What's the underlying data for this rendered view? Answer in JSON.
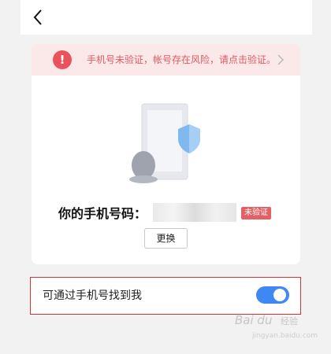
{
  "header": {
    "back_icon": "chevron-left-icon"
  },
  "warning": {
    "text": "手机号未验证，帐号存在风险，请点击验证。",
    "badge": "!",
    "color": "#e05a60"
  },
  "phone": {
    "label": "你的手机号码：",
    "value": "",
    "status_badge": "未验证",
    "change_button": "更换"
  },
  "settings": {
    "find_by_phone_label": "可通过手机号找到我",
    "find_by_phone_enabled": true,
    "toggle_color": "#3f87f5"
  },
  "watermark": {
    "brand": "Bai du",
    "sub": "经验",
    "url": "jingyan.baidu.com"
  }
}
